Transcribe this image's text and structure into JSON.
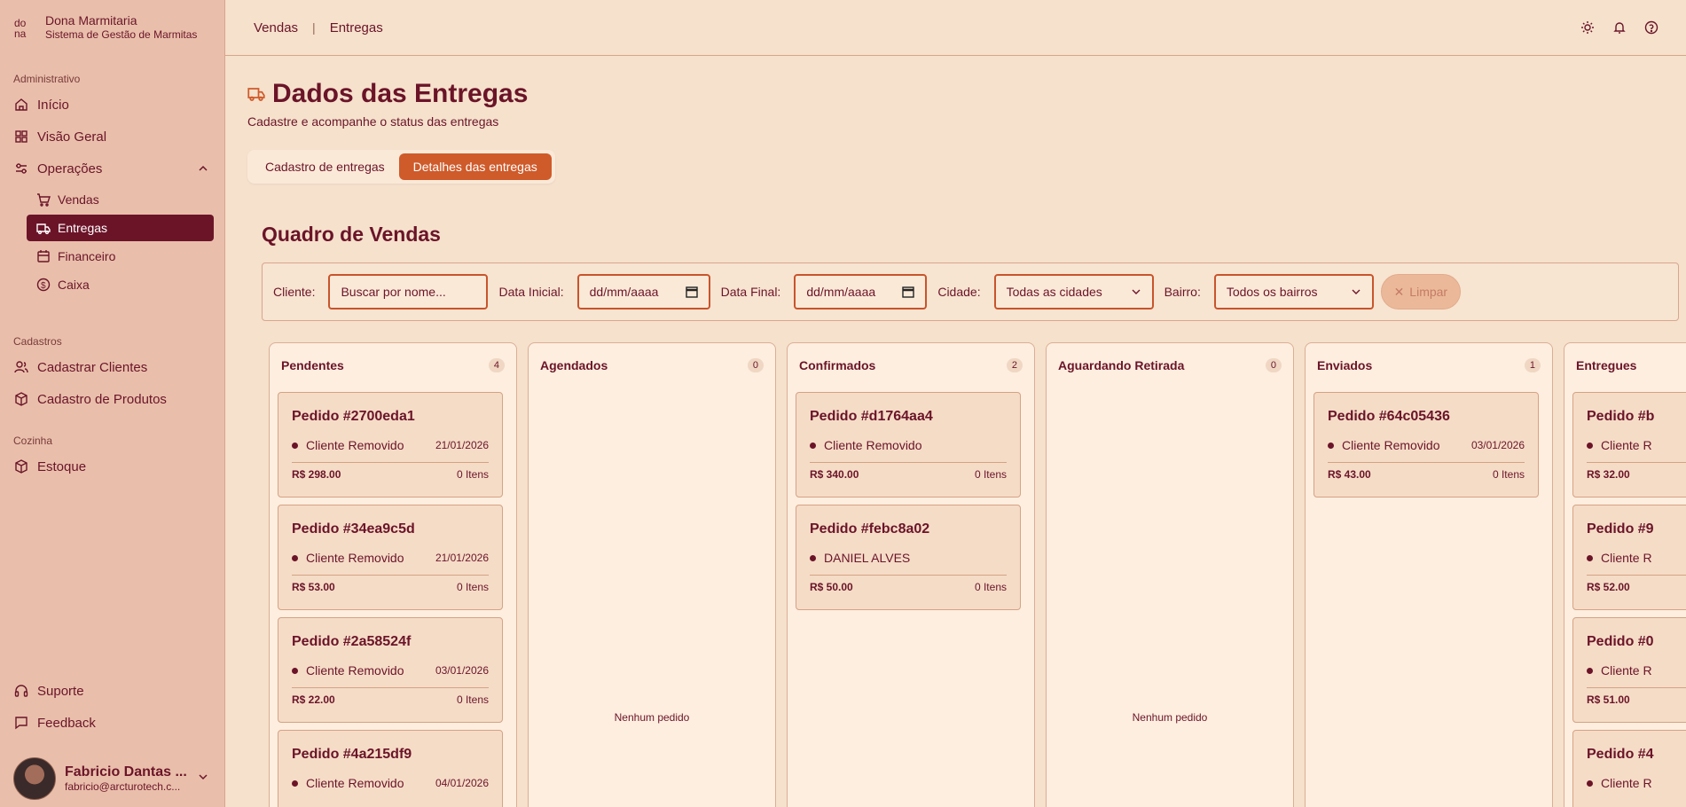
{
  "brand": {
    "name": "Dona Marmitaria",
    "subtitle": "Sistema de Gestão de Marmitas"
  },
  "sidebar": {
    "sections": {
      "admin": "Administrativo",
      "cadastros": "Cadastros",
      "cozinha": "Cozinha"
    },
    "items": {
      "inicio": "Início",
      "visao_geral": "Visão Geral",
      "operacoes": "Operações",
      "vendas": "Vendas",
      "entregas": "Entregas",
      "financeiro": "Financeiro",
      "caixa": "Caixa",
      "cadastrar_clientes": "Cadastrar Clientes",
      "cadastro_produtos": "Cadastro de Produtos",
      "estoque": "Estoque",
      "suporte": "Suporte",
      "feedback": "Feedback"
    },
    "user": {
      "name": "Fabricio Dantas ...",
      "email": "fabricio@arcturotech.c..."
    }
  },
  "breadcrumb": {
    "first": "Vendas",
    "separator": "|",
    "second": "Entregas"
  },
  "page": {
    "title": "Dados das Entregas",
    "subtitle": "Cadastre e acompanhe o status das entregas",
    "tabs": {
      "cadastro": "Cadastro de entregas",
      "detalhes": "Detalhes das entregas"
    },
    "board_title": "Quadro de Vendas"
  },
  "filters": {
    "cliente_label": "Cliente:",
    "cliente_placeholder": "Buscar por nome...",
    "data_inicial_label": "Data Inicial:",
    "data_inicial_value": "dd/mm/aaaa",
    "data_final_label": "Data Final:",
    "data_final_value": "dd/mm/aaaa",
    "cidade_label": "Cidade:",
    "cidade_value": "Todas as cidades",
    "bairro_label": "Bairro:",
    "bairro_value": "Todos os bairros",
    "limpar": "Limpar"
  },
  "columns": [
    {
      "title": "Pendentes",
      "count": "4",
      "cards": [
        {
          "title": "Pedido #2700eda1",
          "client": "Cliente Removido",
          "date": "21/01/2026",
          "price": "R$ 298.00",
          "items": "0 Itens"
        },
        {
          "title": "Pedido #34ea9c5d",
          "client": "Cliente Removido",
          "date": "21/01/2026",
          "price": "R$ 53.00",
          "items": "0 Itens"
        },
        {
          "title": "Pedido #2a58524f",
          "client": "Cliente Removido",
          "date": "03/01/2026",
          "price": "R$ 22.00",
          "items": "0 Itens"
        },
        {
          "title": "Pedido #4a215df9",
          "client": "Cliente Removido",
          "date": "04/01/2026",
          "price": "",
          "items": ""
        }
      ]
    },
    {
      "title": "Agendados",
      "count": "0",
      "empty": "Nenhum pedido"
    },
    {
      "title": "Confirmados",
      "count": "2",
      "cards": [
        {
          "title": "Pedido #d1764aa4",
          "client": "Cliente Removido",
          "date": "",
          "price": "R$ 340.00",
          "items": "0 Itens"
        },
        {
          "title": "Pedido #febc8a02",
          "client": "DANIEL ALVES",
          "date": "",
          "price": "R$ 50.00",
          "items": "0 Itens"
        }
      ]
    },
    {
      "title": "Aguardando Retirada",
      "count": "0",
      "empty": "Nenhum pedido"
    },
    {
      "title": "Enviados",
      "count": "1",
      "cards": [
        {
          "title": "Pedido #64c05436",
          "client": "Cliente Removido",
          "date": "03/01/2026",
          "price": "R$ 43.00",
          "items": "0 Itens"
        }
      ]
    },
    {
      "title": "Entregues",
      "cards": [
        {
          "title": "Pedido #b",
          "client": "Cliente R",
          "price": "R$ 32.00"
        },
        {
          "title": "Pedido #9",
          "client": "Cliente R",
          "price": "R$ 52.00"
        },
        {
          "title": "Pedido #0",
          "client": "Cliente R",
          "price": "R$ 51.00"
        },
        {
          "title": "Pedido #4",
          "client": "Cliente R",
          "price": ""
        }
      ]
    }
  ],
  "colors": {
    "primary": "#6b1428",
    "accent": "#cf5a2a",
    "background": "#f5e1cc",
    "sidebar": "#e9bfab"
  }
}
